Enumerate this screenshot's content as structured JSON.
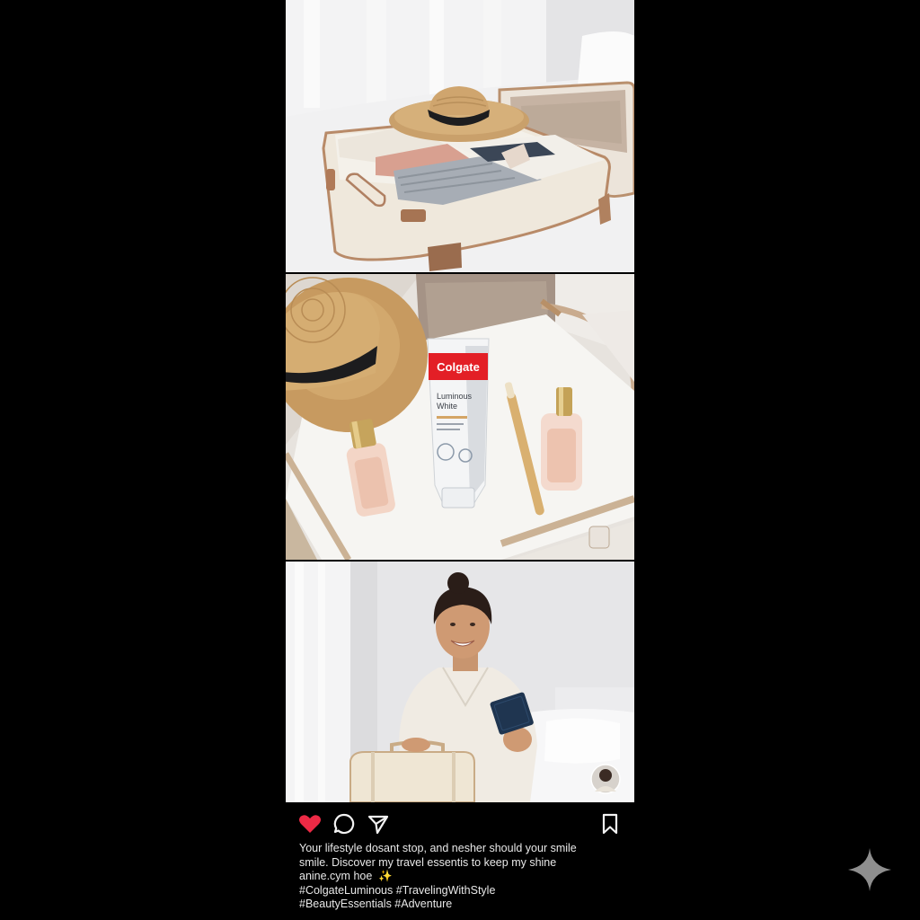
{
  "colors": {
    "like_red": "#ed2a45",
    "brand_red": "#e31f26",
    "background": "#000000"
  },
  "post": {
    "images": [
      {
        "name": "packed-suitcase-with-straw-hat"
      },
      {
        "name": "colgate-toothpaste-with-travel-essentials",
        "product": {
          "brand": "Colgate",
          "line1": "Luminous",
          "line2": "White"
        }
      },
      {
        "name": "smiling-woman-with-passport-and-suitcase"
      }
    ],
    "actions": {
      "like_icon": "heart-icon",
      "comment_icon": "comment-icon",
      "share_icon": "send-icon",
      "save_icon": "bookmark-icon",
      "liked": true
    },
    "caption": {
      "line1": "Your lifestyle dosant stop, and nesher should your smile",
      "line2": "smile. Discover my travel essentis to keep my shine",
      "line3": "anine.cym hoe",
      "line3_emoji": "✨",
      "line4": "#ColgateLuminous #TravelingWithStyle",
      "line5": "#BeautyEssentials #Adventure"
    }
  },
  "watermark_icon": "sparkle-icon"
}
